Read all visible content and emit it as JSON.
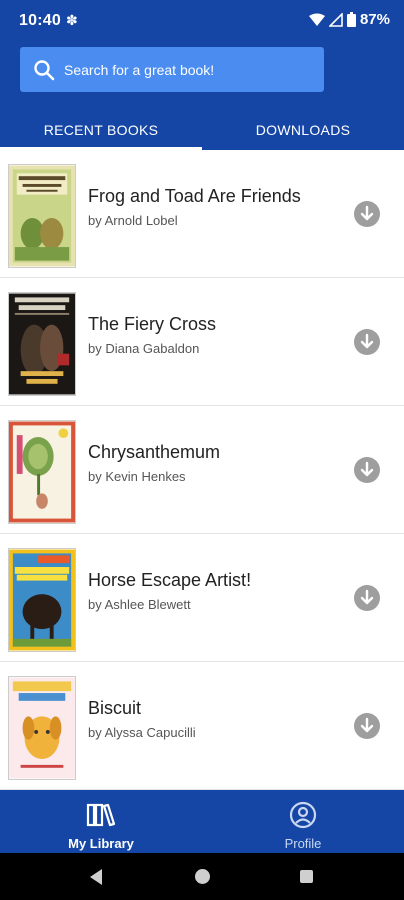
{
  "status_bar": {
    "time": "10:40",
    "battery": "87%"
  },
  "search": {
    "placeholder": "Search for a great book!"
  },
  "tabs": [
    {
      "label": "RECENT BOOKS",
      "active": true
    },
    {
      "label": "DOWNLOADS",
      "active": false
    }
  ],
  "books": [
    {
      "title": "Frog and Toad Are Friends",
      "author": "by Arnold Lobel",
      "cover_icon": "frog-and-toad-cover"
    },
    {
      "title": "The Fiery Cross",
      "author": "by Diana Gabaldon",
      "cover_icon": "fiery-cross-cover"
    },
    {
      "title": "Chrysanthemum",
      "author": "by Kevin Henkes",
      "cover_icon": "chrysanthemum-cover"
    },
    {
      "title": "Horse Escape Artist!",
      "author": "by Ashlee Blewett",
      "cover_icon": "horse-escape-cover"
    },
    {
      "title": "Biscuit",
      "author": "by Alyssa Capucilli",
      "cover_icon": "biscuit-cover"
    }
  ],
  "bottom_nav": [
    {
      "label": "My Library",
      "icon": "library-icon",
      "active": true
    },
    {
      "label": "Profile",
      "icon": "profile-icon",
      "active": false
    }
  ],
  "colors": {
    "primary": "#1546a5",
    "search_bg": "#4a8cf0",
    "download_icon": "#9e9e9e"
  }
}
